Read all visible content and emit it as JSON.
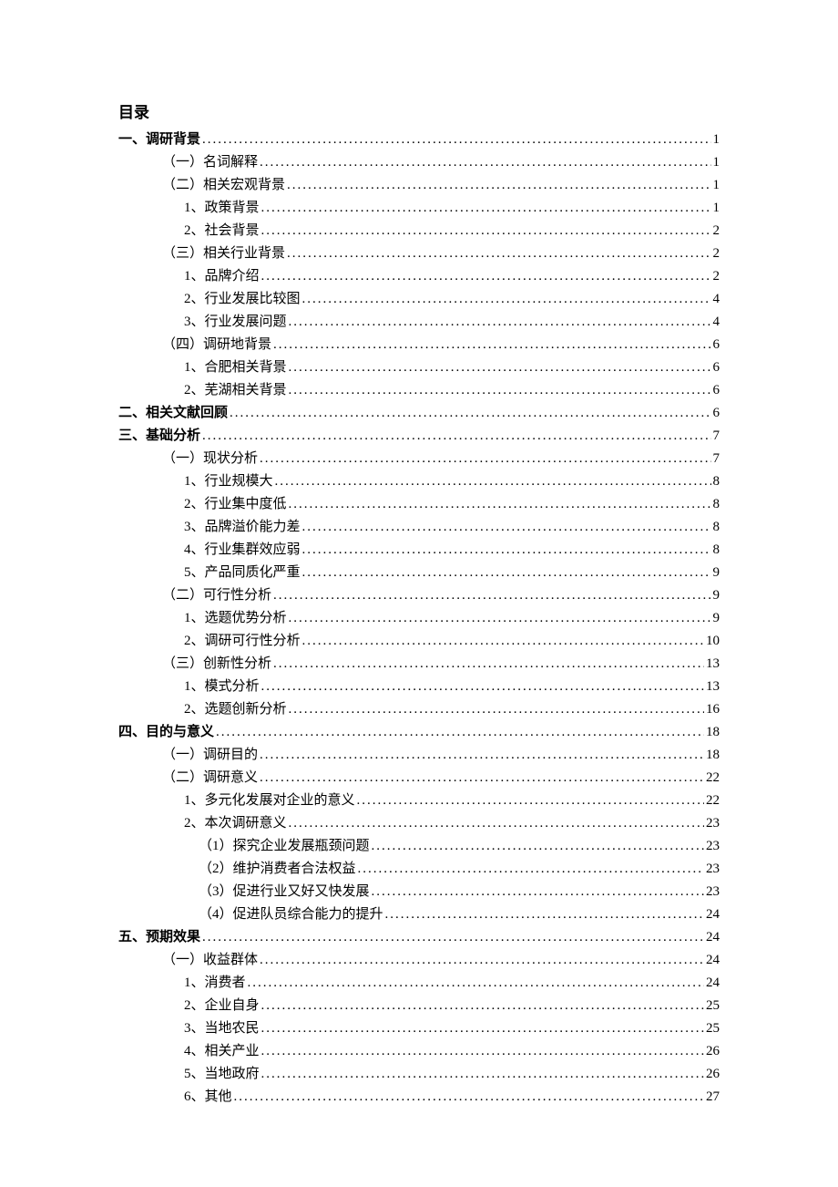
{
  "title": "目录",
  "entries": [
    {
      "label": "一、调研背景",
      "page": "1",
      "level": 0,
      "bold": true
    },
    {
      "label": "（一）名词解释",
      "page": "1",
      "level": 1,
      "bold": false
    },
    {
      "label": "（二）相关宏观背景",
      "page": "1",
      "level": 1,
      "bold": false
    },
    {
      "label": "1、政策背景",
      "page": "1",
      "level": 2,
      "bold": false
    },
    {
      "label": "2、社会背景",
      "page": "2",
      "level": 2,
      "bold": false
    },
    {
      "label": "（三）相关行业背景",
      "page": "2",
      "level": 1,
      "bold": false
    },
    {
      "label": "1、品牌介绍",
      "page": "2",
      "level": 2,
      "bold": false
    },
    {
      "label": "2、行业发展比较图",
      "page": "4",
      "level": 2,
      "bold": false
    },
    {
      "label": "3、行业发展问题",
      "page": "4",
      "level": 2,
      "bold": false
    },
    {
      "label": "（四）调研地背景",
      "page": "6",
      "level": 1,
      "bold": false
    },
    {
      "label": "1、合肥相关背景",
      "page": "6",
      "level": 2,
      "bold": false
    },
    {
      "label": "2、芜湖相关背景",
      "page": "6",
      "level": 2,
      "bold": false
    },
    {
      "label": "二、相关文献回顾",
      "page": "6",
      "level": 0,
      "bold": true
    },
    {
      "label": "三、基础分析",
      "page": "7",
      "level": 0,
      "bold": true
    },
    {
      "label": "（一）现状分析",
      "page": "7",
      "level": 1,
      "bold": false
    },
    {
      "label": "1、行业规模大",
      "page": "8",
      "level": 2,
      "bold": false
    },
    {
      "label": "2、行业集中度低",
      "page": "8",
      "level": 2,
      "bold": false
    },
    {
      "label": "3、品牌溢价能力差",
      "page": "8",
      "level": 2,
      "bold": false
    },
    {
      "label": "4、行业集群效应弱",
      "page": "8",
      "level": 2,
      "bold": false
    },
    {
      "label": "5、产品同质化严重",
      "page": "9",
      "level": 2,
      "bold": false
    },
    {
      "label": "（二）可行性分析",
      "page": "9",
      "level": 1,
      "bold": false
    },
    {
      "label": "1、选题优势分析",
      "page": "9",
      "level": 2,
      "bold": false
    },
    {
      "label": "2、调研可行性分析",
      "page": "10",
      "level": 2,
      "bold": false
    },
    {
      "label": "（三）创新性分析",
      "page": "13",
      "level": 1,
      "bold": false
    },
    {
      "label": "1、模式分析",
      "page": "13",
      "level": 2,
      "bold": false
    },
    {
      "label": "2、选题创新分析",
      "page": "16",
      "level": 2,
      "bold": false
    },
    {
      "label": "四、目的与意义",
      "page": "18",
      "level": 0,
      "bold": true
    },
    {
      "label": "（一）调研目的",
      "page": "18",
      "level": 1,
      "bold": false
    },
    {
      "label": "（二）调研意义",
      "page": "22",
      "level": 1,
      "bold": false
    },
    {
      "label": "1、多元化发展对企业的意义",
      "page": "22",
      "level": 2,
      "bold": false
    },
    {
      "label": "2、本次调研意义",
      "page": "23",
      "level": 2,
      "bold": false
    },
    {
      "label": "（1）探究企业发展瓶颈问题",
      "page": "23",
      "level": 3,
      "bold": false
    },
    {
      "label": "（2）维护消费者合法权益",
      "page": "23",
      "level": 3,
      "bold": false
    },
    {
      "label": "（3）促进行业又好又快发展",
      "page": "23",
      "level": 3,
      "bold": false
    },
    {
      "label": "（4）促进队员综合能力的提升",
      "page": "24",
      "level": 3,
      "bold": false
    },
    {
      "label": "五、预期效果",
      "page": "24",
      "level": 0,
      "bold": true
    },
    {
      "label": "（一）收益群体",
      "page": "24",
      "level": 1,
      "bold": false
    },
    {
      "label": "1、消费者",
      "page": "24",
      "level": 2,
      "bold": false
    },
    {
      "label": "2、企业自身",
      "page": "25",
      "level": 2,
      "bold": false
    },
    {
      "label": "3、当地农民",
      "page": "25",
      "level": 2,
      "bold": false
    },
    {
      "label": "4、相关产业",
      "page": "26",
      "level": 2,
      "bold": false
    },
    {
      "label": "5、当地政府",
      "page": "26",
      "level": 2,
      "bold": false
    },
    {
      "label": "6、其他",
      "page": "27",
      "level": 2,
      "bold": false
    }
  ]
}
